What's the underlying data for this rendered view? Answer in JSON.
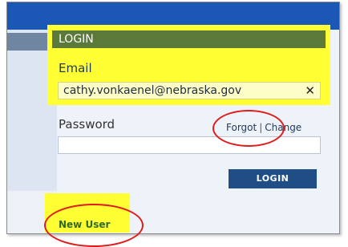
{
  "login": {
    "header": "LOGIN",
    "email_label": "Email",
    "email_value": "cathy.vonkaenel@nebraska.gov",
    "clear_icon": "✕",
    "password_label": "Password",
    "forgot_link": "Forgot",
    "separator": "|",
    "change_link": "Change",
    "login_button": "LOGIN"
  },
  "new_user_link": "New User",
  "colors": {
    "topbar": "#1b57b5",
    "header": "#5b7a3a",
    "highlight": "#ffff33",
    "annotation": "#e01b1b",
    "button": "#1f4e86"
  }
}
